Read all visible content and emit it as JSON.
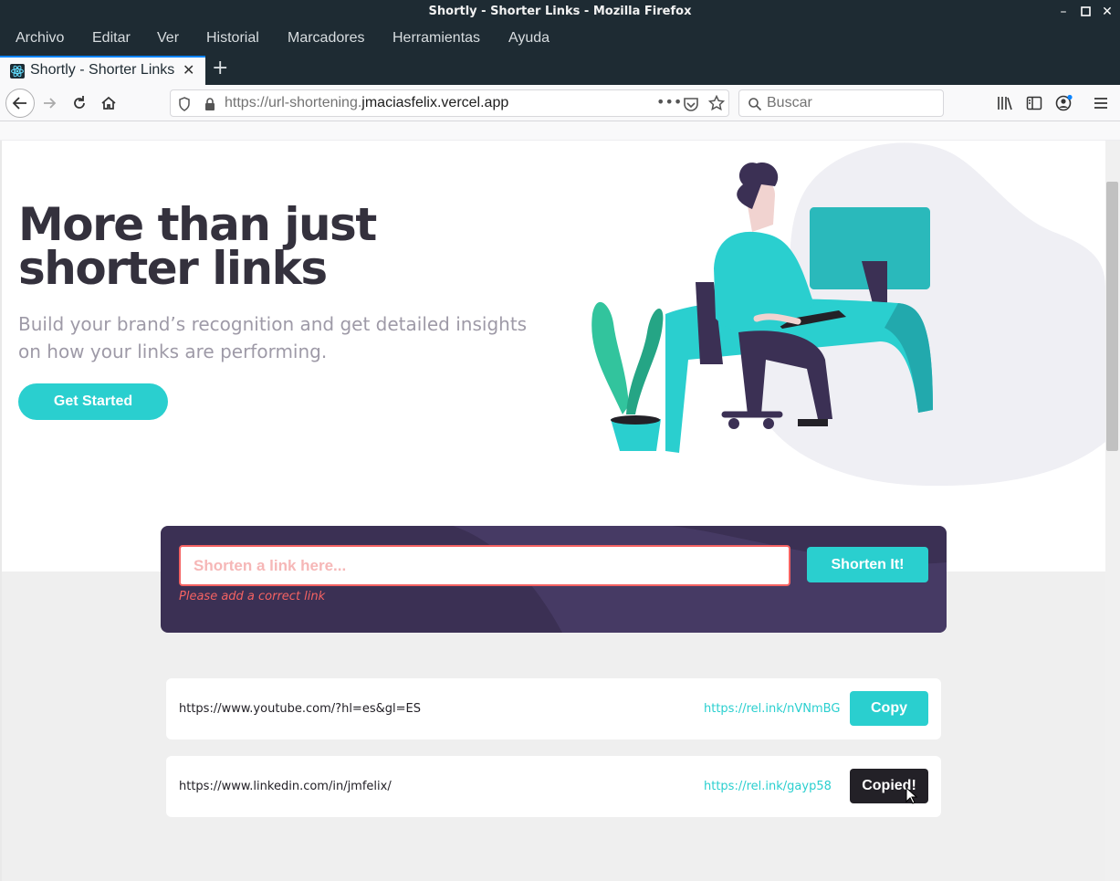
{
  "window": {
    "title": "Shortly - Shorter Links - Mozilla Firefox"
  },
  "menubar": {
    "items": [
      "Archivo",
      "Editar",
      "Ver",
      "Historial",
      "Marcadores",
      "Herramientas",
      "Ayuda"
    ]
  },
  "tabs": [
    {
      "title": "Shortly - Shorter Links",
      "active": true
    }
  ],
  "navbar": {
    "url_prefix": "https://url-shortening.",
    "url_domain": "jmaciasfelix.vercel.app",
    "search_placeholder": "Buscar"
  },
  "hero": {
    "title": "More than just shorter links",
    "subtitle": "Build your brand’s recognition and get detailed insights on how your links are performing.",
    "cta_label": "Get Started"
  },
  "shorten": {
    "placeholder": "Shorten a link here...",
    "button_label": "Shorten It!",
    "error": "Please add a correct link"
  },
  "links": [
    {
      "original": "https://www.youtube.com/?hl=es&gl=ES",
      "short": "https://rel.ink/nVNmBG",
      "button": "Copy",
      "state": "default"
    },
    {
      "original": "https://www.linkedin.com/in/jmfelix/",
      "short": "https://rel.ink/gayp58",
      "button": "Copied!",
      "state": "copied"
    }
  ],
  "colors": {
    "primary_cyan": "#2acfcf",
    "dark_violet": "#3b3054",
    "error_red": "#f46262",
    "very_dark": "#232127",
    "browser_chrome": "#1e2b33"
  }
}
